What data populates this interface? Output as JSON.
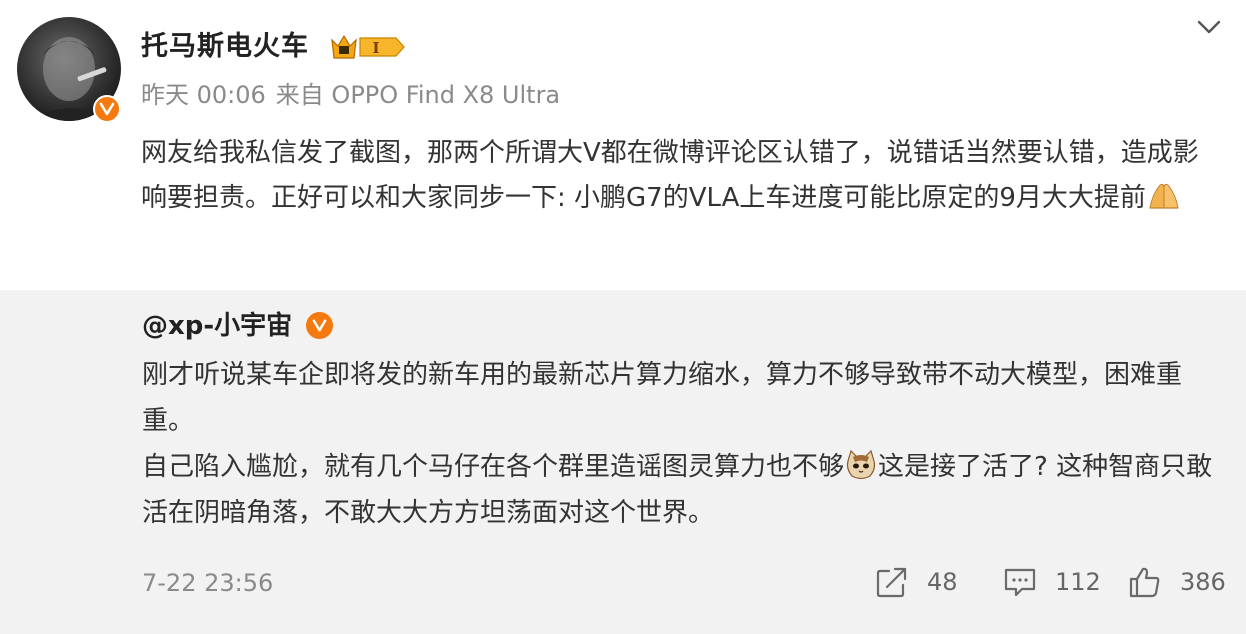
{
  "post": {
    "username": "托马斯电火车",
    "member_badge_text": "I",
    "meta": {
      "time": "昨天 00:06",
      "source": "来自 OPPO Find X8 Ultra"
    },
    "text": "网友给我私信发了截图，那两个所谓大V都在微博评论区认错了，说错话当然要认错，造成影响要担责。正好可以和大家同步一下: 小鹏G7的VLA上车进度可能比原定的9月大大提前",
    "icons": {
      "avatar": "avatar-photo",
      "verified": "v-badge-icon",
      "menu": "chevron-down-icon",
      "emoji": "praying-hands-emoji"
    }
  },
  "repost": {
    "username": "@xp-小宇宙",
    "paragraph1": "刚才听说某车企即将发的新车用的最新芯片算力缩水，算力不够导致带不动大模型，困难重重。",
    "paragraph2_before": "自己陷入尴尬，就有几个马仔在各个群里造谣图灵算力也不够",
    "paragraph2_after": "这是接了活了? 这种智商只敢活在阴暗角落，不敢大大方方坦荡面对这个世界。",
    "date": "7-22 23:56",
    "actions": {
      "repost_count": "48",
      "comment_count": "112",
      "like_count": "386"
    },
    "icons": {
      "emoji": "cat-emoji",
      "repost": "share-icon",
      "comment": "comment-icon",
      "like": "thumbs-up-icon"
    }
  },
  "colors": {
    "accent": "#f5790f",
    "meta_text": "#8a8a8a",
    "repost_bg": "#f2f2f2"
  }
}
